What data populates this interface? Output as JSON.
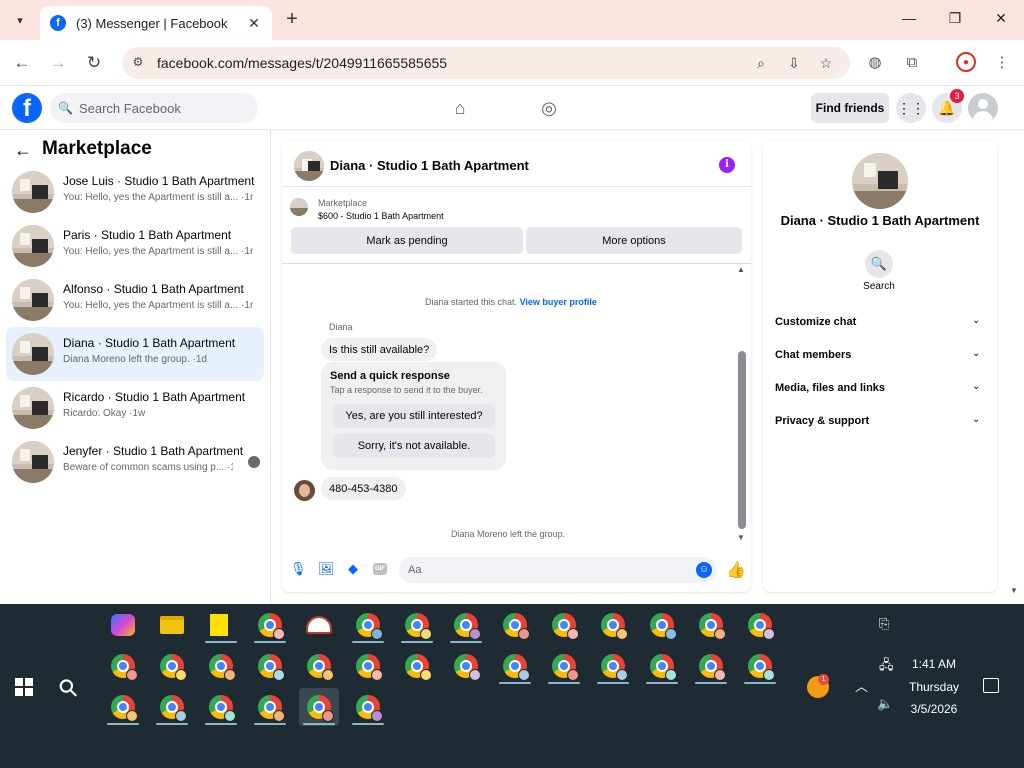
{
  "browser": {
    "tab_title": "(3) Messenger | Facebook",
    "url": "facebook.com/messages/t/2049911665585655",
    "favicon_letter": "f"
  },
  "fb": {
    "logo_letter": "f",
    "search_placeholder": "Search Facebook",
    "find_friends": "Find friends",
    "notif_count": "3"
  },
  "sidebar": {
    "title": "Marketplace",
    "conversations": [
      {
        "name": "Jose Luis · Studio 1 Bath Apartment",
        "preview": "You: Hello, yes the Apartment is still a... ·1m",
        "active": false
      },
      {
        "name": "Paris · Studio 1 Bath Apartment",
        "preview": "You: Hello, yes the Apartment is still a... ·1m",
        "active": false
      },
      {
        "name": "Alfonso · Studio 1 Bath Apartment",
        "preview": "You: Hello, yes the Apartment is still a... ·1m",
        "active": false
      },
      {
        "name": "Diana · Studio 1 Bath Apartment",
        "preview": "Diana Moreno left the group. ·1d",
        "active": true
      },
      {
        "name": "Ricardo · Studio 1 Bath Apartment",
        "preview": "Ricardo: Okay ·1w",
        "active": false
      },
      {
        "name": "Jenyfer · Studio 1 Bath Apartment",
        "preview": "Beware of common scams using p... ·1w",
        "active": false
      }
    ]
  },
  "chat": {
    "title": "Diana · Studio 1 Bath Apartment",
    "listing_label": "Marketplace",
    "listing_price": "$600 - Studio 1 Bath Apartment",
    "btn_pending": "Mark as pending",
    "btn_more": "More options",
    "started_text": "Diana started this chat. ",
    "view_profile": "View buyer profile",
    "sender_name": "Diana",
    "msg1": "Is this still available?",
    "quick_title": "Send a quick response",
    "quick_sub": "Tap a response to send it to the buyer.",
    "quick_opt1": "Yes, are you still interested?",
    "quick_opt2": "Sorry, it's not available.",
    "msg2": "480-453-4380",
    "left_text": "Diana Moreno left the group.",
    "composer_placeholder": "Aa",
    "gif_label": "GIF"
  },
  "details": {
    "title": "Diana · Studio 1 Bath Apartment",
    "search_label": "Search",
    "sections": [
      "Customize chat",
      "Chat members",
      "Media, files and links",
      "Privacy & support"
    ]
  },
  "taskbar": {
    "time": "1:41 AM",
    "day": "Thursday",
    "date": "3/5/2026",
    "weather_badge": "1"
  },
  "colors": {
    "fb_blue": "#0866ff",
    "active_conv": "#e7f0fd",
    "info_purple": "#a020f0",
    "tab_strip": "#fbe3df",
    "taskbar": "#1f2b33"
  }
}
